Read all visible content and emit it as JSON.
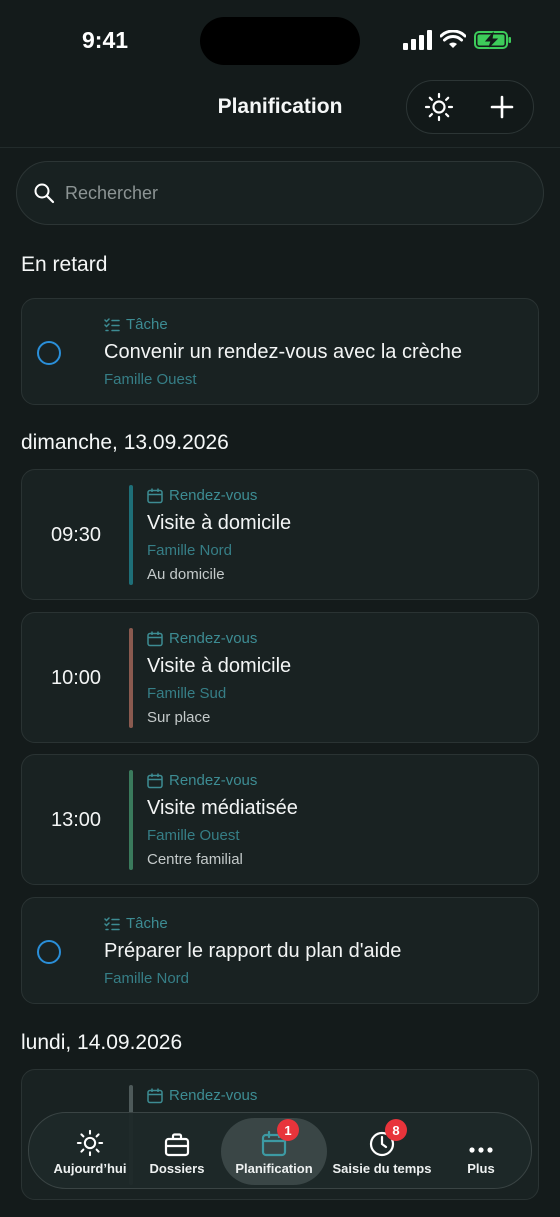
{
  "status_bar": {
    "time": "9:41"
  },
  "header": {
    "title": "Planification",
    "sun_icon": "sun-icon",
    "add_icon": "plus-icon"
  },
  "search": {
    "placeholder": "Rechercher",
    "value": ""
  },
  "sections": [
    {
      "heading": "En retard",
      "items": [
        {
          "kind": "Tâche",
          "title": "Convenir un rendez-vous avec la crèche",
          "family": "Famille Ouest"
        }
      ]
    },
    {
      "heading": "dimanche, 13.09.2026",
      "items": [
        {
          "kind": "Rendez-vous",
          "time": "09:30",
          "title": "Visite à domicile",
          "family": "Famille Nord",
          "place": "Au domicile",
          "color": "#1e6f78"
        },
        {
          "kind": "Rendez-vous",
          "time": "10:00",
          "title": "Visite à domicile",
          "family": "Famille Sud",
          "place": "Sur place",
          "color": "#8a5a4f"
        },
        {
          "kind": "Rendez-vous",
          "time": "13:00",
          "title": "Visite médiatisée",
          "family": "Famille Ouest",
          "place": "Centre familial",
          "color": "#3a7a5c"
        },
        {
          "kind": "Tâche",
          "title": "Préparer le rapport du plan d'aide",
          "family": "Famille Nord"
        }
      ]
    },
    {
      "heading": "lundi, 14.09.2026",
      "items": [
        {
          "kind": "Rendez-vous"
        }
      ]
    }
  ],
  "tabbar": {
    "tabs": [
      {
        "label": "Aujourd’hui",
        "icon": "sun-icon"
      },
      {
        "label": "Dossiers",
        "icon": "briefcase-icon"
      },
      {
        "label": "Planification",
        "icon": "calendar-icon",
        "badge": "1",
        "active": true
      },
      {
        "label": "Saisie du temps",
        "icon": "clock-icon",
        "badge": "8"
      },
      {
        "label": "Plus",
        "icon": "more-icon"
      }
    ]
  },
  "colors": {
    "accent_blue": "#2a8fd9",
    "teal_text": "#3d8c93",
    "badge_red": "#e8343b"
  }
}
